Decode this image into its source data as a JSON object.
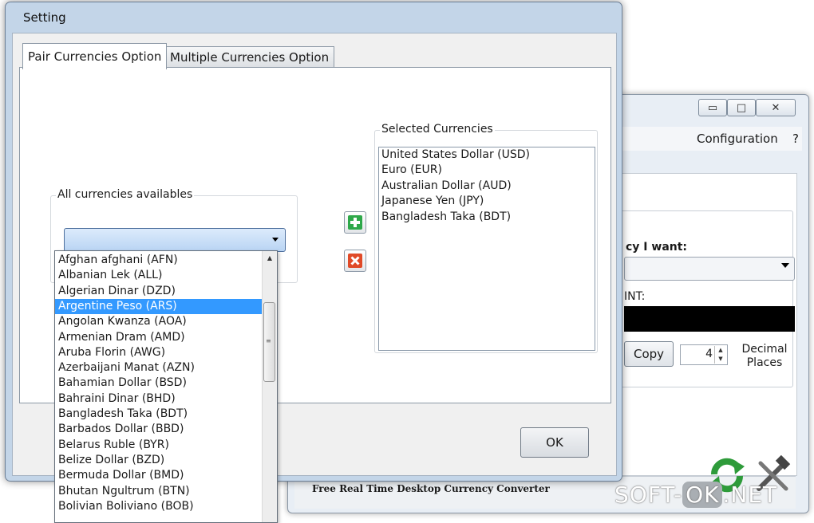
{
  "background_window": {
    "controls": {
      "min": "▭",
      "max": "□",
      "close": "✕"
    },
    "menu": {
      "configuration": "Configuration",
      "help": "?"
    },
    "currency_label": "cy I want:",
    "amount_label": "INT:",
    "copy_label": "Copy",
    "decimal_value": "4",
    "decimal_label": "Decimal Places",
    "footer_text": "Free Real Time Desktop Currency Converter"
  },
  "watermark": {
    "left": "SOFT-",
    "mid": "OK",
    "right": ".NET"
  },
  "dialog": {
    "title": "Setting",
    "tabs": [
      {
        "label": "Pair Currencies Option",
        "active": true
      },
      {
        "label": "Multiple Currencies Option",
        "active": false
      }
    ],
    "all_group_label": "All currencies availables",
    "selected_group_label": "Selected Currencies",
    "selected_currencies": [
      "United States Dollar (USD)",
      "Euro (EUR)",
      "Australian Dollar (AUD)",
      "Japanese Yen (JPY)",
      "Bangladesh Taka (BDT)"
    ],
    "ok_label": "OK"
  },
  "dropdown": {
    "selected_index": 3,
    "items": [
      "Afghan afghani (AFN)",
      "Albanian Lek (ALL)",
      "Algerian Dinar (DZD)",
      "Argentine Peso (ARS)",
      "Angolan Kwanza (AOA)",
      "Armenian Dram (AMD)",
      "Aruba Florin (AWG)",
      "Azerbaijani Manat (AZN)",
      "Bahamian Dollar (BSD)",
      "Bahraini Dinar (BHD)",
      "Bangladesh Taka (BDT)",
      "Barbados Dollar (BBD)",
      "Belarus Ruble (BYR)",
      "Belize Dollar (BZD)",
      "Bermuda Dollar (BMD)",
      "Bhutan Ngultrum (BTN)",
      "Bolivian Boliviano (BOB)"
    ]
  },
  "colors": {
    "selection": "#3399ff",
    "add_icon": "#2ea84a",
    "remove_icon": "#e04a28",
    "window_frame": "#c3d5e8"
  }
}
